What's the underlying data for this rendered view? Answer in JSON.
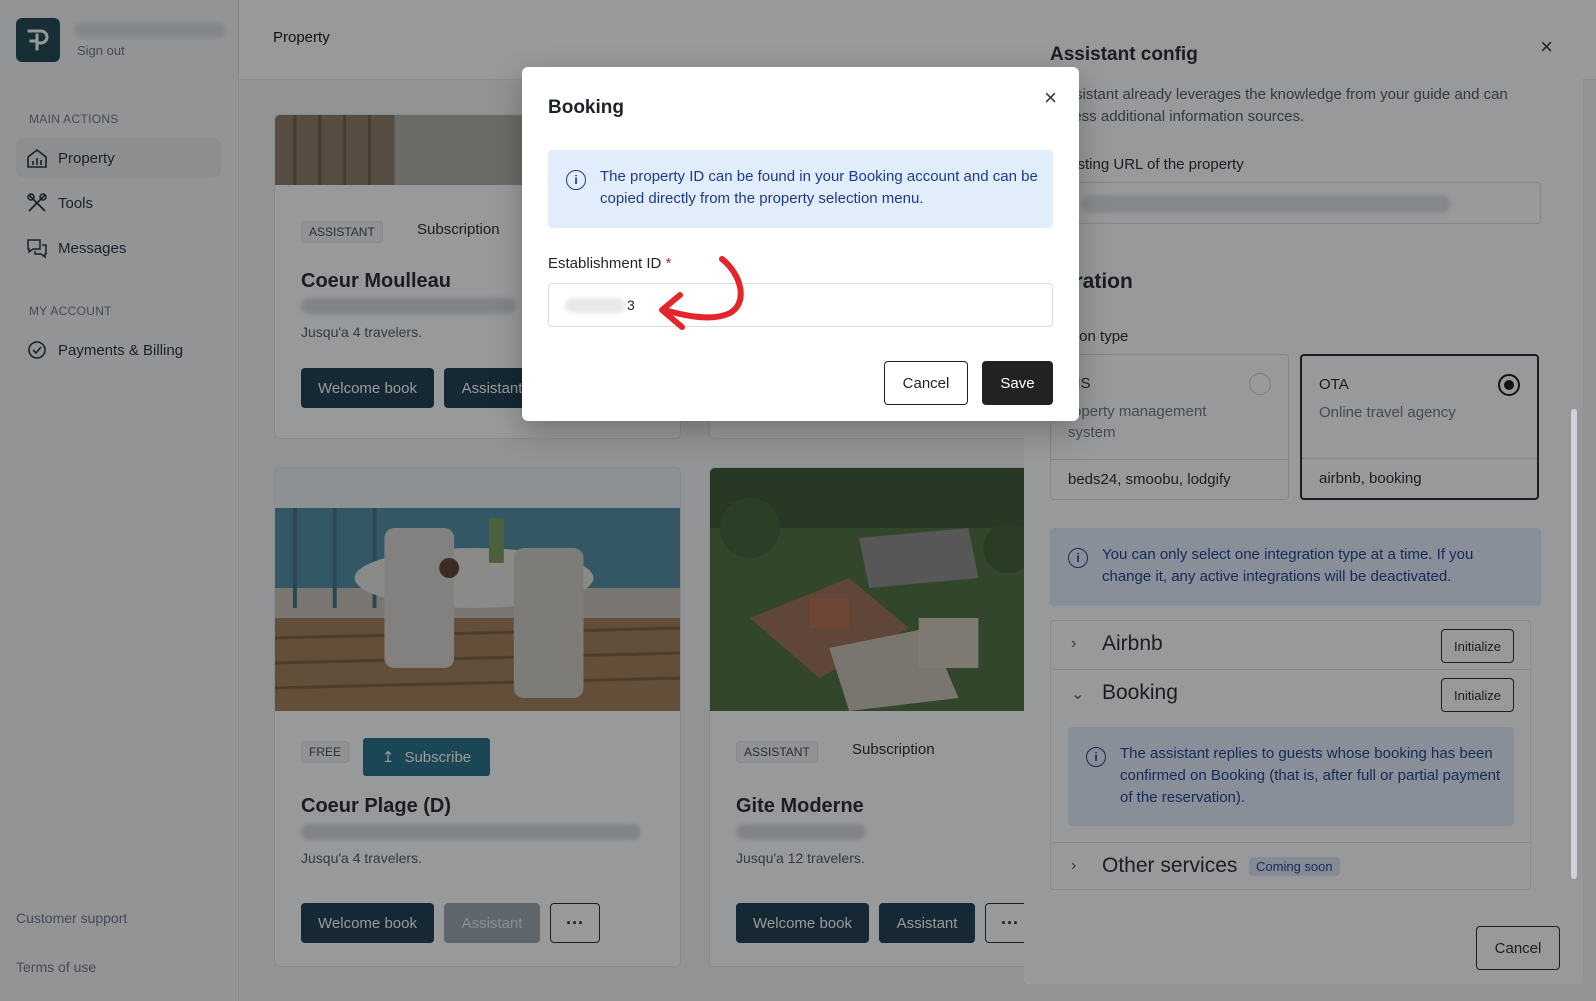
{
  "sidebar": {
    "logo_glyph": "⊣",
    "sign_out": "Sign out",
    "main_actions_label": "MAIN ACTIONS",
    "items": [
      {
        "label": "Property",
        "icon": "home-chart-icon"
      },
      {
        "label": "Tools",
        "icon": "tools-icon"
      },
      {
        "label": "Messages",
        "icon": "messages-icon"
      }
    ],
    "my_account_label": "MY ACCOUNT",
    "account_items": [
      {
        "label": "Payments & Billing",
        "icon": "billing-icon"
      }
    ],
    "footer": {
      "support": "Customer support",
      "terms": "Terms of use"
    }
  },
  "header": {
    "title": "Property"
  },
  "cards": [
    {
      "badge": "ASSISTANT",
      "plan": "Subscription",
      "title": "Coeur Moulleau",
      "travelers": "Jusqu'a 4 travelers.",
      "welcome": "Welcome book",
      "assistant": "Assistant"
    },
    {
      "badge": "FREE",
      "subscribe": "Subscribe",
      "title": "Coeur Plage (D)",
      "travelers": "Jusqu'a 4 travelers.",
      "welcome": "Welcome book",
      "assistant": "Assistant",
      "more": "···"
    },
    {
      "badge": "ASSISTANT",
      "plan": "Subscription",
      "title": "Gite Moderne",
      "travelers": "Jusqu'a 12 travelers.",
      "welcome": "Welcome book",
      "assistant": "Assistant",
      "more": "···"
    }
  ],
  "drawer": {
    "title": "Assistant config",
    "close": "×",
    "description": "r assistant already leverages the knowledge from your guide and can access additional information sources.",
    "url_label": "nb listing URL of the property",
    "url_value": "tp",
    "integration_heading": "egration",
    "integration_type_label": "gration type",
    "options": [
      {
        "title": "MS",
        "description": "roperty management system",
        "footer": "beds24, smoobu, lodgify",
        "selected": false
      },
      {
        "title": "OTA",
        "description": "Online travel agency",
        "footer": "airbnb, booking",
        "selected": true
      }
    ],
    "integration_info": "You can only select one integration type at a time. If you change it, any active integrations will be deactivated.",
    "accordion": [
      {
        "title": "Airbnb",
        "action": "Initialize",
        "expanded": false
      },
      {
        "title": "Booking",
        "action": "Initialize",
        "expanded": true
      },
      {
        "title": "Other services",
        "badge": "Coming soon",
        "expanded": false
      }
    ],
    "booking_info": "The assistant replies to guests whose booking has been confirmed on Booking (that is, after full or partial payment of the reservation).",
    "cancel": "Cancel"
  },
  "modal": {
    "title": "Booking",
    "close": "×",
    "info": "The property ID can be found in your Booking account and can be copied directly from the property selection menu.",
    "field_label": "Establishment ID",
    "required_mark": "*",
    "field_value": "3",
    "cancel": "Cancel",
    "save": "Save"
  },
  "colors": {
    "primary_dark": "#17364a",
    "subscribe": "#1f6c86",
    "info_bg": "#e2edfb",
    "info_text": "#1e3a8a",
    "annotation_arrow": "#e3262b"
  }
}
